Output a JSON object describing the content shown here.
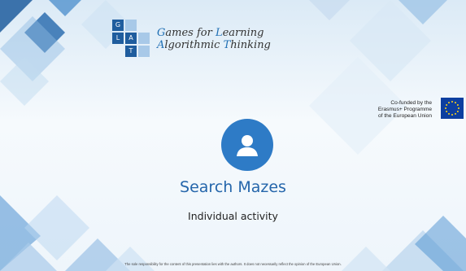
{
  "logo": {
    "cells": [
      "G",
      "",
      "",
      "L",
      "A",
      "",
      "",
      "T",
      ""
    ],
    "line1_a": "G",
    "line1_b": "ames for ",
    "line1_c": "L",
    "line1_d": "earning",
    "line2_a": "A",
    "line2_b": "lgorithmic ",
    "line2_c": "T",
    "line2_d": "hinking"
  },
  "eu": {
    "line1": "Co-funded by the",
    "line2": "Erasmus+ Programme",
    "line3": "of the European Union",
    "flag_icon": "eu-flag-icon"
  },
  "slide": {
    "avatar_icon": "user-avatar-icon",
    "title": "Search Mazes",
    "subtitle": "Individual activity",
    "disclaimer": "The sole responsibility for the content of this presentation lies with the authors. It does not necessarily reflect the opinion of the European Union."
  },
  "colors": {
    "accent": "#2566ab",
    "avatar_bg": "#2e7bc6",
    "logo_dark": "#1f5d9e",
    "logo_light": "#a8c9e8",
    "eu_blue": "#0d3fa0",
    "eu_star": "#ffd617"
  }
}
